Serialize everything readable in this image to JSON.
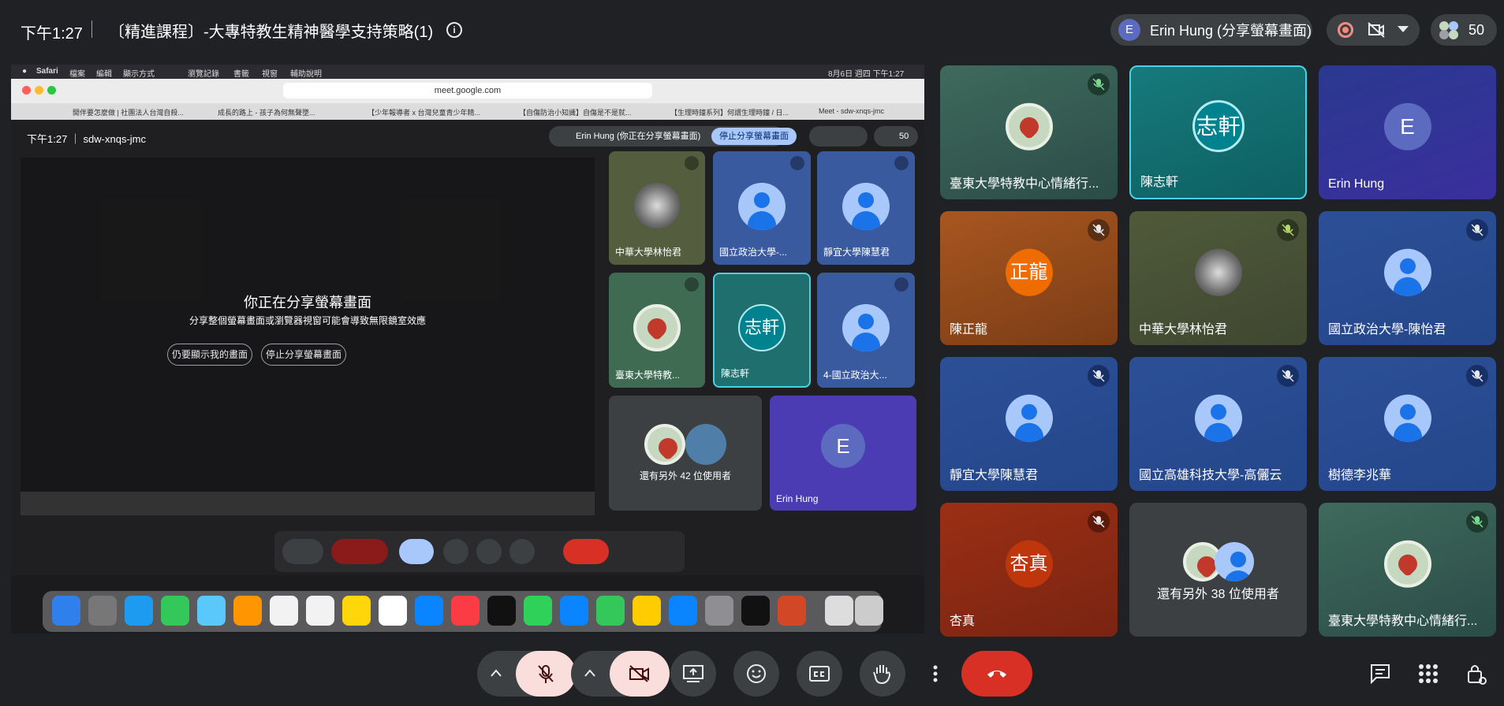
{
  "header": {
    "time": "下午1:27",
    "meeting_title": "〔精進課程〕-大專特教生精神醫學支持策略(1)",
    "presenter_initial": "E",
    "presenter_label": "Erin Hung (分享螢幕畫面)",
    "participant_count": "50"
  },
  "shared_screen": {
    "mac_menu": [
      "Safari",
      "檔案",
      "編輯",
      "顯示方式",
      "瀏覽記錄",
      "書籤",
      "視窗",
      "輔助說明"
    ],
    "mac_clock": "8月6日 週四 下午1:27",
    "url": "meet.google.com",
    "tabs": [
      "開伴要怎麼做 | 社團法人台灣自殺...",
      "成長的路上 - 孩子為何無聲墜...",
      "【少年報導者 x 台灣兒童青少年精...",
      "【自傷防治小知識】自傷是不是就...",
      "【生理時鐘系列】何謂生理時鐘 / 日...",
      "Meet - sdw-xnqs-jmc"
    ],
    "inner_time": "下午1:27",
    "inner_code": "sdw-xnqs-jmc",
    "inner_presenter": "Erin Hung (你正在分享螢幕畫面)",
    "inner_stop": "停止分享螢幕畫面",
    "inner_count": "50",
    "share_heading": "你正在分享螢幕畫面",
    "share_sub": "分享整個螢幕畫面或瀏覽器視窗可能會導致無限鏡室效應",
    "show_anyway": "仍要顯示我的畫面",
    "stop_sharing": "停止分享螢幕畫面",
    "inner_tiles": [
      {
        "name": "中華大學林怡君"
      },
      {
        "name": "國立政治大學-..."
      },
      {
        "name": "靜宜大學陳慧君"
      },
      {
        "name": "臺東大學特教..."
      },
      {
        "name": "陳志軒",
        "initials": "志軒"
      },
      {
        "name": "4-國立政治大..."
      }
    ],
    "inner_others": "還有另外 42 位使用者",
    "inner_erin": "Erin Hung",
    "inner_erin_initial": "E"
  },
  "grid": [
    {
      "name": "臺東大學特教中心情緒行...",
      "type": "heart"
    },
    {
      "name": "陳志軒",
      "initials": "志軒",
      "type": "initials"
    },
    {
      "name": "Erin Hung",
      "initials": "E",
      "type": "initials"
    },
    {
      "name": "陳正龍",
      "initials": "正龍",
      "type": "initials"
    },
    {
      "name": "中華大學林怡君",
      "type": "tree"
    },
    {
      "name": "國立政治大學-陳怡君",
      "type": "person"
    },
    {
      "name": "靜宜大學陳慧君",
      "type": "person"
    },
    {
      "name": "國立高雄科技大學-高儷云",
      "type": "person"
    },
    {
      "name": "樹德李兆華",
      "type": "person"
    },
    {
      "name": "杏真",
      "initials": "杏真",
      "type": "initials"
    },
    {
      "name": "還有另外 38 位使用者",
      "type": "others"
    },
    {
      "name": "臺東大學特教中心情緒行...",
      "type": "heart"
    }
  ],
  "colors": {
    "accent": "#a8c7fa",
    "hangup": "#d93025",
    "active_border": "#4dd0e1",
    "muted_pink": "#f9dedc"
  },
  "icons": [
    "info-icon",
    "record-icon",
    "camera-off-icon",
    "people-icon",
    "mic-off-icon",
    "present-icon",
    "emoji-icon",
    "captions-icon",
    "raise-hand-icon",
    "more-icon",
    "hangup-icon",
    "chat-icon",
    "apps-icon",
    "host-controls-icon"
  ]
}
